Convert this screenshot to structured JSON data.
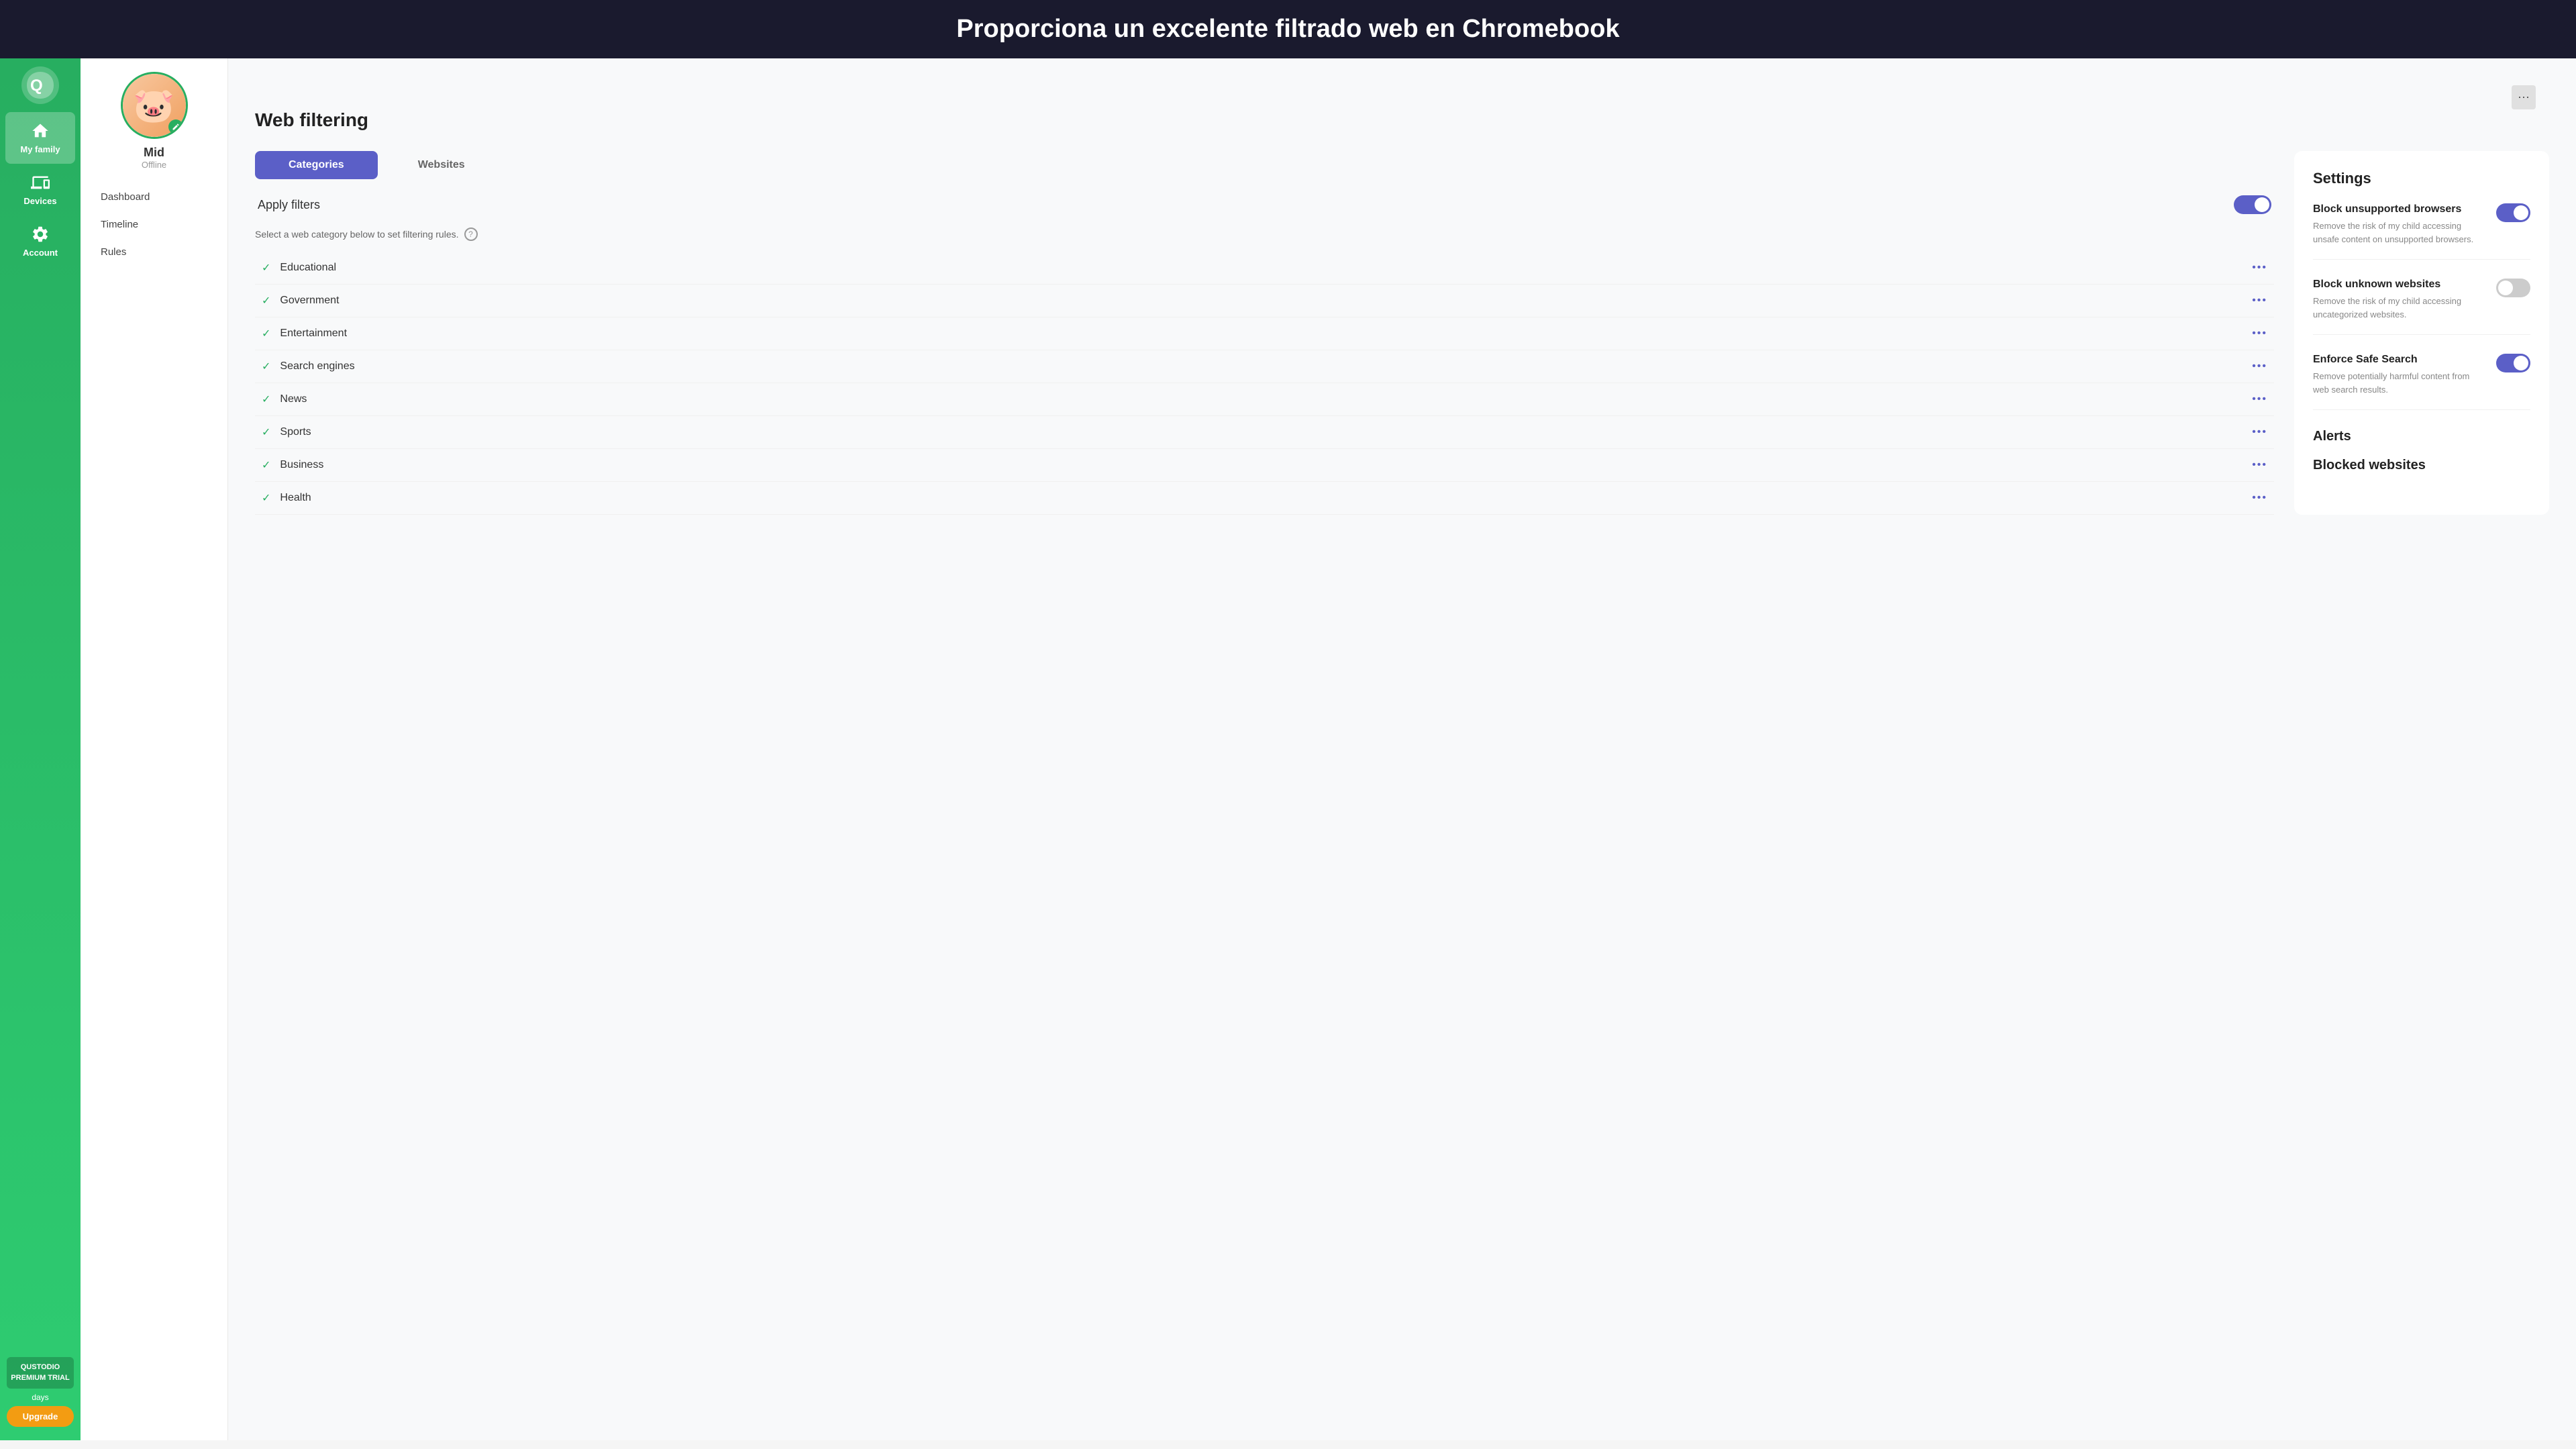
{
  "banner": {
    "text": "Proporciona un excelente filtrado web en Chromebook"
  },
  "sidebar": {
    "logo_alt": "Qustodio logo",
    "nav_items": [
      {
        "id": "my-family",
        "label": "My family",
        "icon": "home",
        "active": true
      },
      {
        "id": "devices",
        "label": "Devices",
        "icon": "devices",
        "active": false
      },
      {
        "id": "account",
        "label": "Account",
        "icon": "gear",
        "active": false
      }
    ],
    "premium_label": "QUSTODIO\nPREMIUM\nTRIAL",
    "days_label": "days",
    "upgrade_label": "Upgrade"
  },
  "profile": {
    "name": "Mid",
    "status": "Offline",
    "nav_items": [
      "Dashboard",
      "Timeline",
      "Rules"
    ]
  },
  "main": {
    "title": "Web filtering",
    "tabs": [
      {
        "id": "categories",
        "label": "Categories",
        "active": true
      },
      {
        "id": "websites",
        "label": "Websites",
        "active": false
      }
    ],
    "apply_filters_label": "Apply filters",
    "apply_filters_on": true,
    "helper_text": "Select a web category below to set filtering rules.",
    "categories": [
      {
        "id": "educational",
        "name": "Educational",
        "allowed": true
      },
      {
        "id": "government",
        "name": "Government",
        "allowed": true
      },
      {
        "id": "entertainment",
        "name": "Entertainment",
        "allowed": true
      },
      {
        "id": "search-engines",
        "name": "Search engines",
        "allowed": true
      },
      {
        "id": "news",
        "name": "News",
        "allowed": true
      },
      {
        "id": "sports",
        "name": "Sports",
        "allowed": true
      },
      {
        "id": "business",
        "name": "Business",
        "allowed": true
      },
      {
        "id": "health",
        "name": "Health",
        "allowed": true
      }
    ]
  },
  "settings": {
    "title": "Settings",
    "items": [
      {
        "id": "block-unsupported",
        "title": "Block unsupported browsers",
        "description": "Remove the risk of my child accessing unsafe content on unsupported browsers.",
        "enabled": true
      },
      {
        "id": "block-unknown",
        "title": "Block unknown websites",
        "description": "Remove the risk of my child accessing uncategorized websites.",
        "enabled": false
      },
      {
        "id": "enforce-safe-search",
        "title": "Enforce Safe Search",
        "description": "Remove potentially harmful content from web search results.",
        "enabled": true
      }
    ],
    "alerts_title": "Alerts",
    "blocked_title": "Blocked websites"
  },
  "colors": {
    "green": "#27ae60",
    "purple": "#5b5fc7",
    "orange": "#f39c12",
    "sidebar_bg": "#2ecc71"
  }
}
